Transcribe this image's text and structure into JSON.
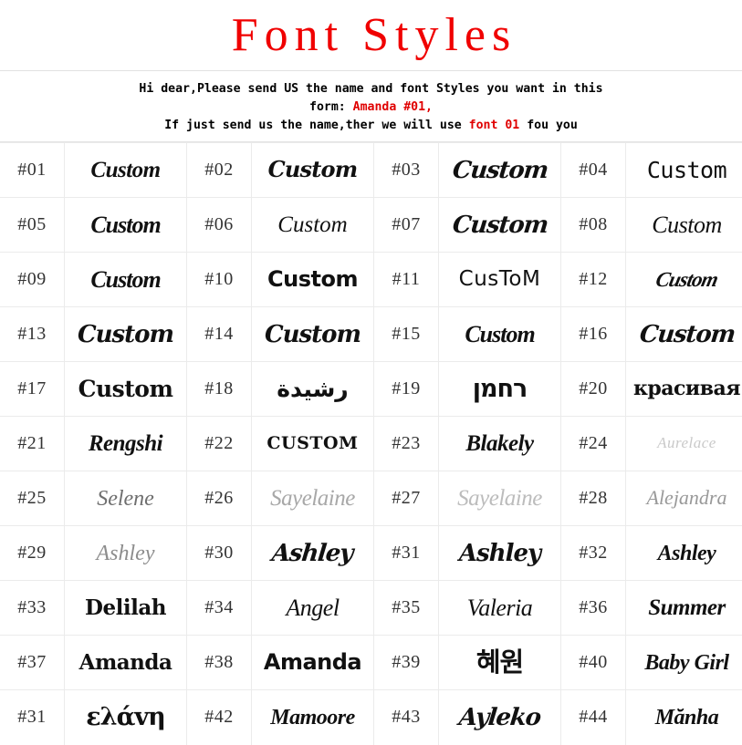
{
  "header": {
    "title": "Font Styles",
    "intro_line1": "Hi dear,Please send US the name and font Styles you want in this",
    "intro_line2_prefix": "form: ",
    "intro_line2_highlight": "Amanda #01,",
    "intro_line3_prefix": "If just send us the name,ther we will use ",
    "intro_line3_highlight": "font 01",
    "intro_line3_suffix": " fou you",
    "title_color": "#f00000",
    "highlight_color": "#e00000"
  },
  "grid": {
    "columns": 4,
    "rows": 11,
    "cells": [
      {
        "num": "#01",
        "sample": "Custom",
        "style": "s-script-bi"
      },
      {
        "num": "#02",
        "sample": "Custom",
        "style": "s-script-bi2"
      },
      {
        "num": "#03",
        "sample": "Custom",
        "style": "s-script-hvy"
      },
      {
        "num": "#04",
        "sample": "Custom",
        "style": "s-slab"
      },
      {
        "num": "#05",
        "sample": "Custom",
        "style": "s-swash"
      },
      {
        "num": "#06",
        "sample": "Custom",
        "style": "s-thinscript"
      },
      {
        "num": "#07",
        "sample": "Custom",
        "style": "s-script-hvy"
      },
      {
        "num": "#08",
        "sample": "Custom",
        "style": "s-elegant"
      },
      {
        "num": "#09",
        "sample": "Custom",
        "style": "s-swash"
      },
      {
        "num": "#10",
        "sample": "Custom",
        "style": "s-hand"
      },
      {
        "num": "#11",
        "sample": "CusToM",
        "style": "s-marker"
      },
      {
        "num": "#12",
        "sample": "Custom",
        "style": "s-brush"
      },
      {
        "num": "#13",
        "sample": "Custom",
        "style": "s-bold-it"
      },
      {
        "num": "#14",
        "sample": "Custom",
        "style": "s-bold-it"
      },
      {
        "num": "#15",
        "sample": "Custom",
        "style": "s-swash"
      },
      {
        "num": "#16",
        "sample": "Custom",
        "style": "s-script-hvy"
      },
      {
        "num": "#17",
        "sample": "Custom",
        "style": "s-gothic"
      },
      {
        "num": "#18",
        "sample": "رشيدة",
        "style": "s-arabic"
      },
      {
        "num": "#19",
        "sample": "רחמן",
        "style": "s-hebrew"
      },
      {
        "num": "#20",
        "sample": "красивая",
        "style": "s-cyr"
      },
      {
        "num": "#21",
        "sample": "Rengshi",
        "style": "s-sign"
      },
      {
        "num": "#22",
        "sample": "CUSTOM",
        "style": "s-collegiate"
      },
      {
        "num": "#23",
        "sample": "Blakely",
        "style": "s-sign"
      },
      {
        "num": "#24",
        "sample": "Aurelace",
        "style": "s-faint"
      },
      {
        "num": "#25",
        "sample": "Selene",
        "style": "s-light1"
      },
      {
        "num": "#26",
        "sample": "Sayelaine",
        "style": "s-light2"
      },
      {
        "num": "#27",
        "sample": "Sayelaine",
        "style": "s-light3"
      },
      {
        "num": "#28",
        "sample": "Alejandra",
        "style": "s-light4"
      },
      {
        "num": "#29",
        "sample": "Ashley",
        "style": "s-light5"
      },
      {
        "num": "#30",
        "sample": "Ashley",
        "style": "s-script-hvy"
      },
      {
        "num": "#31",
        "sample": "Ashley",
        "style": "s-bold-it"
      },
      {
        "num": "#32",
        "sample": "Ashley",
        "style": "s-tall"
      },
      {
        "num": "#33",
        "sample": "Delilah",
        "style": "s-chunky"
      },
      {
        "num": "#34",
        "sample": "Angel",
        "style": "s-elegant"
      },
      {
        "num": "#35",
        "sample": "Valeria",
        "style": "s-elegant"
      },
      {
        "num": "#36",
        "sample": "Summer",
        "style": "s-sign"
      },
      {
        "num": "#37",
        "sample": "Amanda",
        "style": "s-chunky"
      },
      {
        "num": "#38",
        "sample": "Amanda",
        "style": "s-hand"
      },
      {
        "num": "#39",
        "sample": "혜원",
        "style": "s-korean"
      },
      {
        "num": "#40",
        "sample": "Baby Girl",
        "style": "s-tall"
      },
      {
        "num": "#31",
        "sample": "ελάvη",
        "style": "s-greek"
      },
      {
        "num": "#42",
        "sample": "Mamoore",
        "style": "s-tall"
      },
      {
        "num": "#43",
        "sample": "Ayleko",
        "style": "s-script-hvy"
      },
      {
        "num": "#44",
        "sample": "Mănha",
        "style": "s-tall"
      }
    ]
  }
}
